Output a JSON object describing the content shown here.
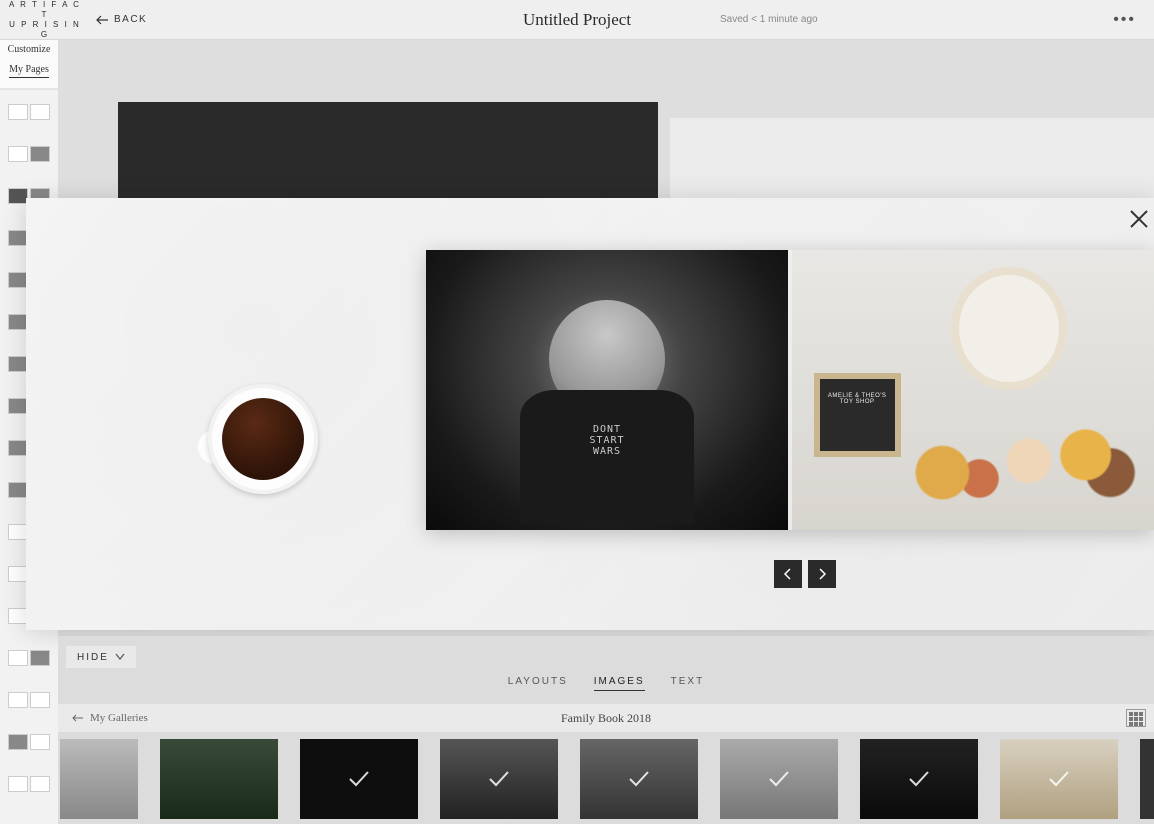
{
  "header": {
    "logo_line1": "A R T I F A C T",
    "logo_line2": "U P R I S I N G",
    "back_label": "BACK",
    "project_title": "Untitled Project",
    "saved_status": "Saved < 1 minute ago"
  },
  "sidebar": {
    "tab1": "Customize",
    "tab2": "My Pages"
  },
  "modal": {
    "shirt_line1": "DONT",
    "shirt_line2": "START",
    "shirt_line3": "WARS",
    "letterboard_line1": "AMELIE & THEO'S",
    "letterboard_line2": "TOY SHOP"
  },
  "bottom": {
    "hide_label": "HIDE",
    "tabs": {
      "layouts": "LAYOUTS",
      "images": "IMAGES",
      "text": "TEXT"
    },
    "galleries_back": "My Galleries",
    "gallery_name": "Family Book 2018"
  }
}
